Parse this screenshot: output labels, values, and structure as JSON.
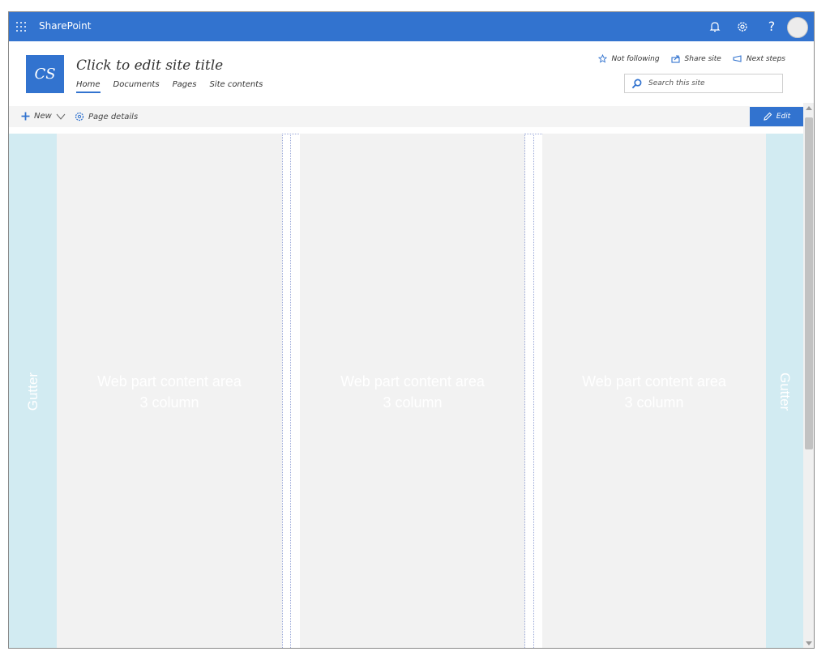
{
  "suite_bar": {
    "app_name": "SharePoint",
    "icons": [
      "waffle-icon",
      "bell-icon",
      "gear-icon",
      "help-icon",
      "avatar"
    ],
    "help_label": "?"
  },
  "header": {
    "logo_text": "CS",
    "site_title": "Click to edit site title",
    "nav": [
      "Home",
      "Documents",
      "Pages",
      "Site contents"
    ],
    "active_nav": "Home",
    "actions": {
      "follow": "Not following",
      "share": "Share site",
      "next": "Next steps"
    },
    "search_placeholder": "Search this site"
  },
  "command_bar": {
    "new_label": "New",
    "page_details_label": "Page details",
    "edit_label": "Edit"
  },
  "canvas": {
    "gutter_label": "Gutter",
    "columns": [
      {
        "line1": "Web part content area",
        "line2": "3 column"
      },
      {
        "line1": "Web part content area",
        "line2": "3 column"
      },
      {
        "line1": "Web part content area",
        "line2": "3 column"
      }
    ]
  },
  "colors": {
    "accent": "#3273cf",
    "gutter": "#d2ebf2",
    "column": "#f2f2f2"
  }
}
